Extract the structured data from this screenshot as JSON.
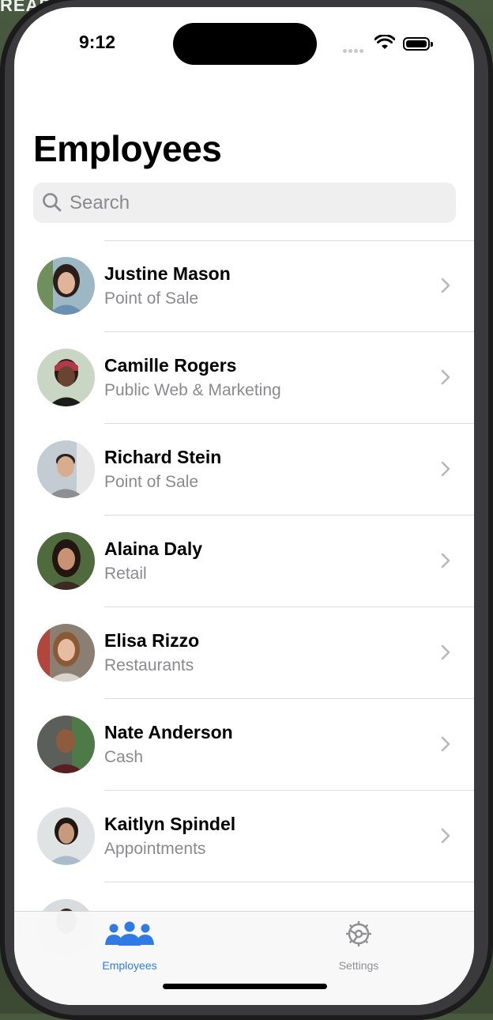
{
  "background_text": "READ",
  "status_bar": {
    "time": "9:12"
  },
  "page": {
    "title": "Employees"
  },
  "search": {
    "placeholder": "Search"
  },
  "employees": [
    {
      "name": "Justine Mason",
      "department": "Point of Sale"
    },
    {
      "name": "Camille Rogers",
      "department": "Public Web & Marketing"
    },
    {
      "name": "Richard Stein",
      "department": "Point of Sale"
    },
    {
      "name": "Alaina Daly",
      "department": "Retail"
    },
    {
      "name": "Elisa Rizzo",
      "department": "Restaurants"
    },
    {
      "name": "Nate Anderson",
      "department": "Cash"
    },
    {
      "name": "Kaitlyn Spindel",
      "department": "Appointments"
    }
  ],
  "tab_bar": {
    "tabs": [
      {
        "label": "Employees",
        "icon": "people-icon",
        "selected": true
      },
      {
        "label": "Settings",
        "icon": "gear-icon",
        "selected": false
      }
    ]
  },
  "colors": {
    "accent": "#2f7be6",
    "inactive": "#8e8e93",
    "secondary_text": "#8a8a8e"
  }
}
